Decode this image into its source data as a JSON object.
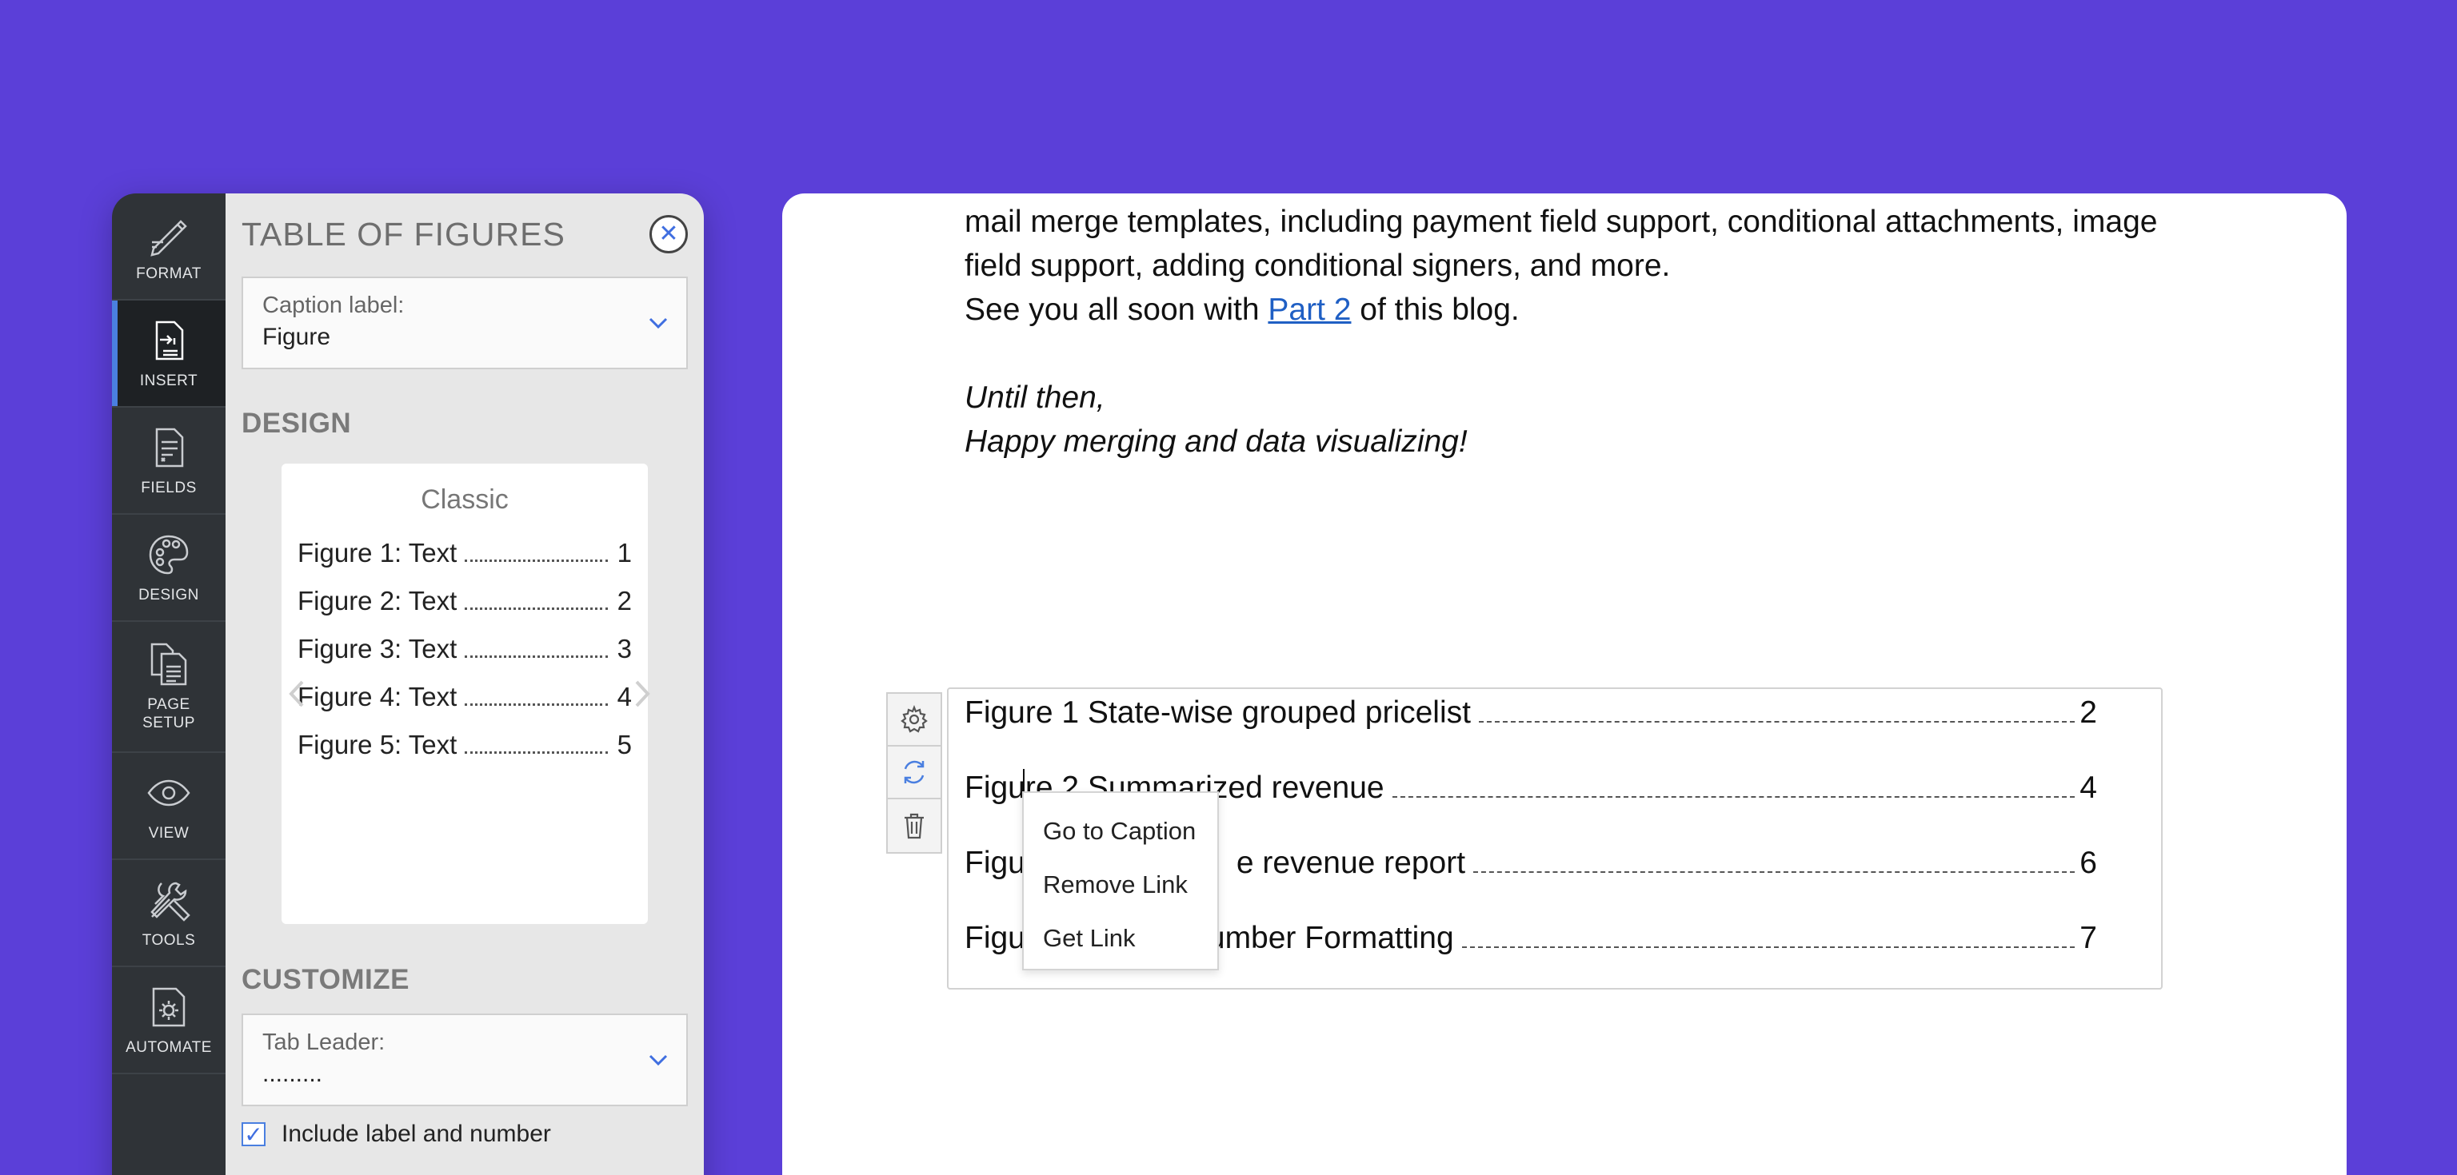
{
  "rail": {
    "items": [
      {
        "label": "FORMAT",
        "icon": "pen-ruler-icon"
      },
      {
        "label": "INSERT",
        "icon": "insert-document-icon",
        "active": true
      },
      {
        "label": "FIELDS",
        "icon": "fields-document-icon"
      },
      {
        "label": "DESIGN",
        "icon": "palette-icon"
      },
      {
        "label": "PAGE\nSETUP",
        "icon": "page-setup-icon"
      },
      {
        "label": "VIEW",
        "icon": "eye-icon"
      },
      {
        "label": "TOOLS",
        "icon": "tools-icon"
      },
      {
        "label": "AUTOMATE",
        "icon": "automate-gear-icon"
      }
    ]
  },
  "sidebar": {
    "title": "TABLE OF FIGURES",
    "caption_label": {
      "label": "Caption label:",
      "value": "Figure"
    },
    "design_title": "DESIGN",
    "design_card": {
      "name": "Classic",
      "lines": [
        {
          "text": "Figure 1: Text",
          "page": "1"
        },
        {
          "text": "Figure 2: Text",
          "page": "2"
        },
        {
          "text": "Figure 3: Text",
          "page": "3"
        },
        {
          "text": "Figure 4: Text",
          "page": "4"
        },
        {
          "text": "Figure 5: Text",
          "page": "5"
        }
      ]
    },
    "customize_title": "CUSTOMIZE",
    "tab_leader": {
      "label": "Tab Leader:",
      "value": "........."
    },
    "include_label": {
      "label": "Include label and number",
      "checked": true
    }
  },
  "document": {
    "line1": "mail merge templates, including payment field support, conditional attachments, image",
    "line2": "field support, adding conditional signers, and more.",
    "line3_before": "See you all soon with ",
    "line3_link": "Part 2",
    "line3_after": " of this blog.",
    "italic1": "Until then,",
    "italic2": "Happy merging and data visualizing!"
  },
  "table_of_figures": {
    "entries": [
      {
        "text": "Figure 1 State-wise grouped pricelist",
        "page": "2"
      },
      {
        "text": "Figure 2 Summarized revenue",
        "page": "4"
      },
      {
        "text": "Figure 3 State-wise revenue report",
        "page": "6"
      },
      {
        "text": "Figure 4 Number Formatting",
        "page": "7"
      }
    ],
    "visible_entries": [
      {
        "text": "Figure 1 State-wise grouped pricelist",
        "page": "2"
      },
      {
        "text": "Figure 2 Summarized revenue",
        "page": "4"
      },
      {
        "text_left": "Figu",
        "text_right": "e revenue report",
        "page": "6"
      },
      {
        "text_left": "Figu",
        "text_right": "umber Formatting",
        "page": "7"
      }
    ]
  },
  "context_menu": {
    "items": [
      "Go to Caption",
      "Remove Link",
      "Get Link"
    ]
  },
  "tool_strip": {
    "items": [
      "gear-icon",
      "refresh-icon",
      "trash-icon"
    ]
  },
  "colors": {
    "background": "#5b3fd8",
    "rail": "#2f3337",
    "accent": "#4a7fe0",
    "link": "#1f5fc4"
  }
}
